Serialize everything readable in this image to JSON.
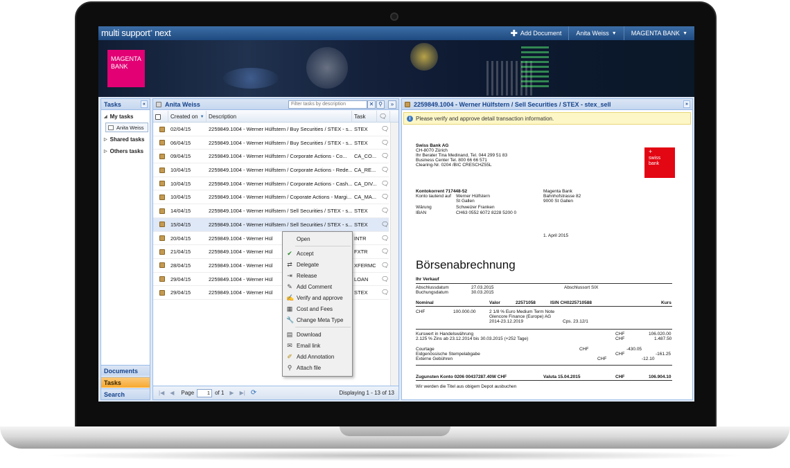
{
  "app": {
    "brand": "multi support",
    "brand_suffix": "next",
    "add_document": "Add Document",
    "user_menu": "Anita Weiss",
    "bank_menu": "MAGENTA BANK",
    "logo_line1": "MAGENTA",
    "logo_line2": "BANK"
  },
  "sidebar": {
    "title": "Tasks",
    "my_tasks": "My tasks",
    "user_leaf": "Anita Weiss",
    "shared_tasks": "Shared tasks",
    "others_tasks": "Others tasks",
    "accordion": [
      "Documents",
      "Tasks",
      "Search"
    ]
  },
  "grid": {
    "title": "Anita Weiss",
    "filter_placeholder": "Filter tasks by description",
    "columns": [
      "Created on",
      "Description",
      "Task"
    ],
    "rows": [
      {
        "date": "02/04/15",
        "desc": "2259849.1004 - Werner Hülfstern / Buy Securities / STEX - s...",
        "task": "STEX"
      },
      {
        "date": "06/04/15",
        "desc": "2259849.1004 - Werner Hülfstern / Buy Securities / STEX - s...",
        "task": "STEX"
      },
      {
        "date": "09/04/15",
        "desc": "2259849.1004 - Werner Hülfstern / Corporate Actions - Co...",
        "task": "CA_CO..."
      },
      {
        "date": "10/04/15",
        "desc": "2259849.1004 - Werner Hülfstern / Corporate Actions - Rede...",
        "task": "CA_RE..."
      },
      {
        "date": "10/04/15",
        "desc": "2259849.1004 - Werner Hülfstern / Corporate Actions - Cash...",
        "task": "CA_DIV..."
      },
      {
        "date": "10/04/15",
        "desc": "2259849.1004 - Werner Hülfstern / Coporate Actions - Margi...",
        "task": "CA_MA..."
      },
      {
        "date": "14/04/15",
        "desc": "2259849.1004 - Werner Hülfstern / Sell Securities / STEX - s...",
        "task": "STEX"
      },
      {
        "date": "15/04/15",
        "desc": "2259849.1004 - Werner Hülfstern / Sell Securities / STEX - s...",
        "task": "STEX"
      },
      {
        "date": "20/04/15",
        "desc": "2259849.1004 - Werner Hül",
        "task": "INTR"
      },
      {
        "date": "21/04/15",
        "desc": "2259849.1004 - Werner Hül",
        "task": "FXTR"
      },
      {
        "date": "28/04/15",
        "desc": "2259849.1004 - Werner Hül",
        "task": "XFERMC"
      },
      {
        "date": "29/04/15",
        "desc": "2259849.1004 - Werner Hül",
        "task": "LOAN"
      },
      {
        "date": "29/04/15",
        "desc": "2259849.1004 - Werner Hül",
        "task": "STEX"
      }
    ],
    "pager": {
      "page_label": "Page",
      "page_value": "1",
      "of_label": "of 1",
      "display": "Displaying 1 - 13 of 13"
    }
  },
  "context_menu": {
    "items": [
      "Open",
      "Accept",
      "Delegate",
      "Release",
      "Add Comment",
      "Verify and approve",
      "Cost and Fees",
      "Change Meta Type",
      "Download",
      "Email link",
      "Add Annotation",
      "Attach file"
    ]
  },
  "document": {
    "title": "2259849.1004 - Werner Hülfstern / Sell Securities / STEX - stex_sell",
    "notice": "Please verify and approve detail transaction information.",
    "bank_name": "Swiss Bank AG",
    "bank_addr1": "CH-8070 Zürich",
    "bank_addr2": "Ihr Berater Tina Medinand, Tel. 044 299 51 83",
    "bank_addr3": "Business Center Tel. 800 66 66 571",
    "bank_addr4": "Clearing-Nr. 0204 /BIC CRESCHZ55L",
    "logo_top": "+",
    "logo_l1": "swiss",
    "logo_l2": "bank",
    "konto_label": "Kontokorrent  717448-52",
    "konto_lautend": "Konto lautend auf",
    "holder1": "Werner Hülfstern",
    "holder2": "St Gallen",
    "waehrung_label": "Wärung",
    "waehrung": "Schweizer Franken",
    "iban_label": "IBAN",
    "iban": "CH63 0552 6072 8228 5200 0",
    "rcpt1": "Magenta Bank",
    "rcpt2": "Bahnhofstrasse 82",
    "rcpt3": "9000 St Gallen",
    "date": "1. April 2015",
    "heading": "Börsenabrechnung",
    "sub": "Ihr Verkauf",
    "abschluss_label": "Abschlussdatum",
    "abschluss": "27.03.2015",
    "abschlussort": "Abschlussort SIX",
    "buchung_label": "Buchungsdatum",
    "buchung": "30.03.2015",
    "nominal": "Nominal",
    "valor_label": "Valor",
    "valor": "22571058",
    "isin": "ISIN CH0225710588",
    "kurs": "Kurs",
    "chf": "CHF",
    "amount": "100.000.00",
    "sec1": "2 1/8 % Euro Medium Term Note",
    "sec2": "Glencore Finance (Europe) AG",
    "sec3": "2014-23.12.2019",
    "cps": "Cps. 23.12/1",
    "kurswert": "Kurswert in Handelswährung",
    "kurswert_val": "106.020.00",
    "zins": "2.125 % Zins ab 23.12.2014 bis 30.03.2015 (+252 Tage)",
    "zins_val": "1.487.50",
    "courtage": "Courtage",
    "courtage_val": "-430.05",
    "stempel": "Eidgenössische Stempelabgabe",
    "stempel_val": "-161.25",
    "gebuehren": "Externe Gebühren",
    "gebuehren_val": "-12.10",
    "zugunsten": "Zugunsten Konto 0206 00437287.40W CHF",
    "valuta": "Valuta 15.04.2015",
    "total": "106.904.10",
    "footer": "Wir werden die Titel aus obigem Depot ausbuchen"
  }
}
